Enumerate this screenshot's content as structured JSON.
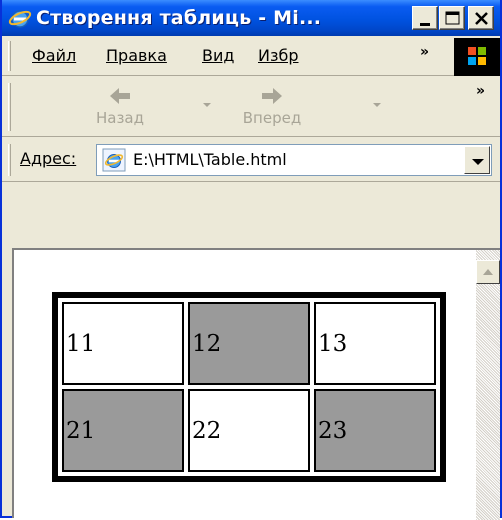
{
  "window": {
    "title": "Створення таблиць - Mi...",
    "controls": {
      "minimize": "minimize",
      "maximize": "maximize",
      "close": "close"
    }
  },
  "menu": {
    "items": [
      {
        "label": "Файл"
      },
      {
        "label": "Правка"
      },
      {
        "label": "Вид"
      },
      {
        "label": "Избр"
      }
    ],
    "overflow": "»"
  },
  "toolbar": {
    "back_label": "Назад",
    "forward_label": "Вперед",
    "overflow": "»"
  },
  "address": {
    "label": "Адрес:",
    "value": "E:\\HTML\\Table.html"
  },
  "page": {
    "table": {
      "rows": [
        [
          {
            "text": "11",
            "shaded": false
          },
          {
            "text": "12",
            "shaded": true
          },
          {
            "text": "13",
            "shaded": false
          }
        ],
        [
          {
            "text": "21",
            "shaded": true
          },
          {
            "text": "22",
            "shaded": false
          },
          {
            "text": "23",
            "shaded": true
          }
        ]
      ],
      "shade_color": "#9a9a9a"
    }
  },
  "colors": {
    "titlebar": "#0052e0",
    "chrome": "#ece9d8"
  }
}
